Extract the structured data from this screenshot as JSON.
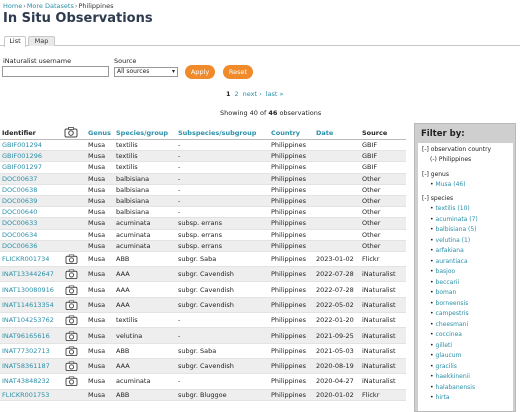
{
  "breadcrumb": {
    "home": "Home",
    "datasets": "More Datasets",
    "current": "Philippines",
    "sep": "›"
  },
  "page_title": "In Situ Observations",
  "tabs": [
    {
      "label": "List"
    },
    {
      "label": "Map"
    }
  ],
  "form": {
    "username_label": "iNaturalist username",
    "username_value": "",
    "source_label": "Source",
    "source_value": "All sources",
    "apply_label": "Apply",
    "reset_label": "Reset"
  },
  "pager": {
    "current": "1",
    "page2": "2",
    "next": "next ›",
    "last": "last »"
  },
  "showing": {
    "prefix": "Showing 40 of ",
    "total": "46",
    "suffix": " observations"
  },
  "columns": {
    "identifier": "Identifier",
    "genus": "Genus",
    "species": "Species/group",
    "subspecies": "Subspecies/subgroup",
    "country": "Country",
    "date": "Date",
    "source": "Source"
  },
  "rows": [
    {
      "id": "GBIF001294",
      "cam": false,
      "genus": "Musa",
      "species": "textilis",
      "sub": "-",
      "country": "Philippines",
      "date": "",
      "source": "GBIF"
    },
    {
      "id": "GBIF001296",
      "cam": false,
      "genus": "Musa",
      "species": "textilis",
      "sub": "-",
      "country": "Philippines",
      "date": "",
      "source": "GBIF"
    },
    {
      "id": "GBIF001297",
      "cam": false,
      "genus": "Musa",
      "species": "textilis",
      "sub": "-",
      "country": "Philippines",
      "date": "",
      "source": "GBIF"
    },
    {
      "id": "DOC00637",
      "cam": false,
      "genus": "Musa",
      "species": "balbisiana",
      "sub": "-",
      "country": "Philippines",
      "date": "",
      "source": "Other"
    },
    {
      "id": "DOC00638",
      "cam": false,
      "genus": "Musa",
      "species": "balbisiana",
      "sub": "-",
      "country": "Philippines",
      "date": "",
      "source": "Other"
    },
    {
      "id": "DOC00639",
      "cam": false,
      "genus": "Musa",
      "species": "balbisiana",
      "sub": "-",
      "country": "Philippines",
      "date": "",
      "source": "Other"
    },
    {
      "id": "DOC00640",
      "cam": false,
      "genus": "Musa",
      "species": "balbisiana",
      "sub": "-",
      "country": "Philippines",
      "date": "",
      "source": "Other"
    },
    {
      "id": "DOC00633",
      "cam": false,
      "genus": "Musa",
      "species": "acuminata",
      "sub": "subsp. errans",
      "country": "Philippines",
      "date": "",
      "source": "Other"
    },
    {
      "id": "DOC00634",
      "cam": false,
      "genus": "Musa",
      "species": "acuminata",
      "sub": "subsp. errans",
      "country": "Philippines",
      "date": "",
      "source": "Other"
    },
    {
      "id": "DOC00636",
      "cam": false,
      "genus": "Musa",
      "species": "acuminata",
      "sub": "subsp. errans",
      "country": "Philippines",
      "date": "",
      "source": "Other"
    },
    {
      "id": "FLICKR001734",
      "cam": true,
      "genus": "Musa",
      "species": "ABB",
      "sub": "subgr. Saba",
      "country": "Philippines",
      "date": "2023-01-02",
      "source": "Flickr"
    },
    {
      "id": "INAT133442647",
      "cam": true,
      "genus": "Musa",
      "species": "AAA",
      "sub": "subgr. Cavendish",
      "country": "Philippines",
      "date": "2022-07-28",
      "source": "iNaturalist"
    },
    {
      "id": "INAT130080916",
      "cam": true,
      "genus": "Musa",
      "species": "AAA",
      "sub": "subgr. Cavendish",
      "country": "Philippines",
      "date": "2022-07-28",
      "source": "iNaturalist"
    },
    {
      "id": "INAT114613354",
      "cam": true,
      "genus": "Musa",
      "species": "AAA",
      "sub": "subgr. Cavendish",
      "country": "Philippines",
      "date": "2022-05-02",
      "source": "iNaturalist"
    },
    {
      "id": "INAT104253762",
      "cam": true,
      "genus": "Musa",
      "species": "textilis",
      "sub": "-",
      "country": "Philippines",
      "date": "2022-01-20",
      "source": "iNaturalist"
    },
    {
      "id": "INAT96165616",
      "cam": true,
      "genus": "Musa",
      "species": "velutina",
      "sub": "-",
      "country": "Philippines",
      "date": "2021-09-25",
      "source": "iNaturalist"
    },
    {
      "id": "INAT77302713",
      "cam": true,
      "genus": "Musa",
      "species": "ABB",
      "sub": "subgr. Saba",
      "country": "Philippines",
      "date": "2021-05-03",
      "source": "iNaturalist"
    },
    {
      "id": "INAT58361187",
      "cam": true,
      "genus": "Musa",
      "species": "AAA",
      "sub": "subgr. Cavendish",
      "country": "Philippines",
      "date": "2020-08-19",
      "source": "iNaturalist"
    },
    {
      "id": "INAT43848232",
      "cam": true,
      "genus": "Musa",
      "species": "acuminata",
      "sub": "-",
      "country": "Philippines",
      "date": "2020-04-27",
      "source": "iNaturalist"
    },
    {
      "id": "FLICKR001753",
      "cam": false,
      "genus": "Musa",
      "species": "ABB",
      "sub": "subgr. Bluggoe",
      "country": "Philippines",
      "date": "2020-01-02",
      "source": "Flickr"
    }
  ],
  "filter": {
    "title": "Filter by:",
    "sections": [
      {
        "head": "[-] observation country",
        "items": [
          {
            "prefix": "(-)",
            "label": "Philippines",
            "link": false
          }
        ]
      },
      {
        "head": "[-] genus",
        "items": [
          {
            "prefix": "•",
            "label": "Musa (46)",
            "link": true
          }
        ]
      },
      {
        "head": "[-] species",
        "items": [
          {
            "prefix": "•",
            "label": "textilis (10)",
            "link": true
          },
          {
            "prefix": "•",
            "label": "acuminata (7)",
            "link": true
          },
          {
            "prefix": "•",
            "label": "balbisiana (5)",
            "link": true
          },
          {
            "prefix": "•",
            "label": "velutina (1)",
            "link": true
          },
          {
            "prefix": "•",
            "label": "arfakiana",
            "link": true
          },
          {
            "prefix": "•",
            "label": "aurantiaca",
            "link": true
          },
          {
            "prefix": "•",
            "label": "basjoo",
            "link": true
          },
          {
            "prefix": "•",
            "label": "beccarii",
            "link": true
          },
          {
            "prefix": "•",
            "label": "boman",
            "link": true
          },
          {
            "prefix": "•",
            "label": "borneensis",
            "link": true
          },
          {
            "prefix": "•",
            "label": "campestris",
            "link": true
          },
          {
            "prefix": "•",
            "label": "cheesmani",
            "link": true
          },
          {
            "prefix": "•",
            "label": "coccinea",
            "link": true
          },
          {
            "prefix": "•",
            "label": "gilleti",
            "link": true
          },
          {
            "prefix": "•",
            "label": "glaucum",
            "link": true
          },
          {
            "prefix": "•",
            "label": "gracilis",
            "link": true
          },
          {
            "prefix": "•",
            "label": "haekkinenii",
            "link": true
          },
          {
            "prefix": "•",
            "label": "halabanensis",
            "link": true
          },
          {
            "prefix": "•",
            "label": "hirta",
            "link": true
          }
        ]
      }
    ]
  },
  "colors": {
    "accent": "#2a8fa8",
    "button": "#f08a2a",
    "title": "#2e3b4e"
  }
}
